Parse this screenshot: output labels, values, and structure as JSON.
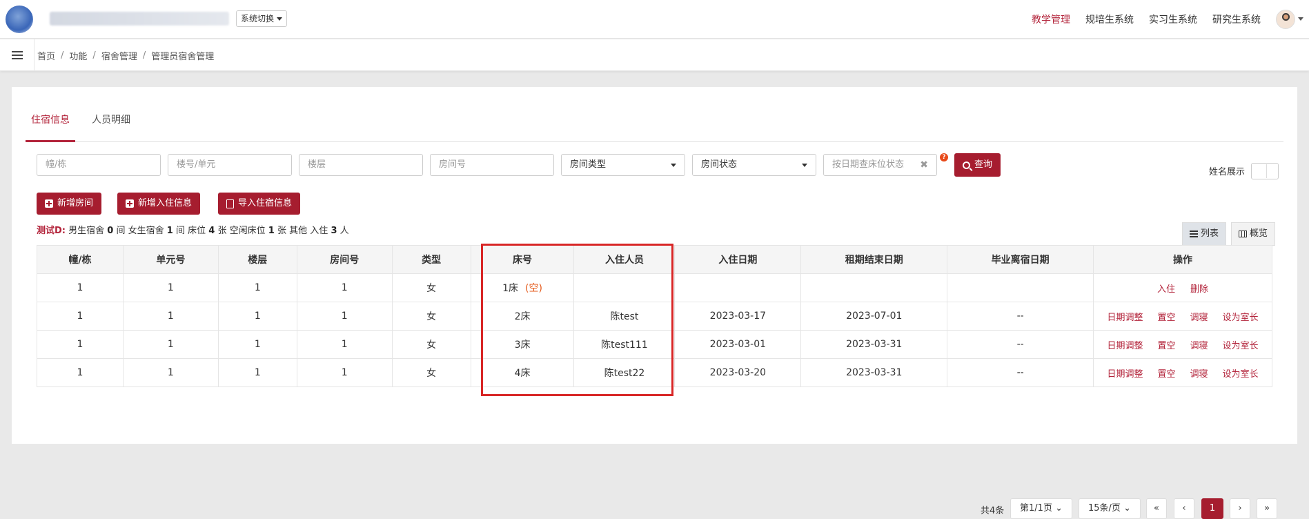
{
  "header": {
    "system_switch": "系统切换",
    "nav": [
      "教学管理",
      "规培生系统",
      "实习生系统",
      "研究生系统"
    ],
    "active_nav": "教学管理"
  },
  "breadcrumb": [
    "首页",
    "功能",
    "宿舍管理",
    "管理员宿舍管理"
  ],
  "tabs": [
    "住宿信息",
    "人员明细"
  ],
  "filters": {
    "building_placeholder": "幢/栋",
    "unit_placeholder": "楼号/单元",
    "floor_placeholder": "楼层",
    "room_placeholder": "房间号",
    "room_type": "房间类型",
    "room_status": "房间状态",
    "date_placeholder": "按日期查床位状态",
    "search_label": "查询"
  },
  "actions": {
    "add_room": "新增房间",
    "add_checkin": "新增入住信息",
    "import": "导入住宿信息"
  },
  "stats": {
    "name": "测试D:",
    "text_male": "男生宿舍",
    "male": "0",
    "unit_room": "间",
    "text_female": "女生宿舍",
    "female": "1",
    "text_beds": "床位",
    "beds": "4",
    "unit_bed": "张",
    "text_free": "空闲床位",
    "free": "1",
    "text_other": "其他",
    "text_checkin": "入住",
    "checkin": "3",
    "unit_person": "人"
  },
  "name_display_label": "姓名展示",
  "view": {
    "list": "列表",
    "overview": "概览"
  },
  "table": {
    "headers": [
      "幢/栋",
      "单元号",
      "楼层",
      "房间号",
      "类型",
      "床号",
      "入住人员",
      "入住日期",
      "租期结束日期",
      "毕业离宿日期",
      "操作"
    ],
    "rows": [
      {
        "building": "1",
        "unit": "1",
        "floor": "1",
        "room": "1",
        "type": "女",
        "bed": "1床",
        "empty": "(空)",
        "person": "",
        "checkin": "",
        "lease_end": "",
        "leave": "",
        "ops": [
          "入住",
          "删除"
        ]
      },
      {
        "building": "1",
        "unit": "1",
        "floor": "1",
        "room": "1",
        "type": "女",
        "bed": "2床",
        "empty": "",
        "person": "陈test",
        "checkin": "2023-03-17",
        "lease_end": "2023-07-01",
        "leave": "--",
        "ops": [
          "日期调整",
          "置空",
          "调寝",
          "设为室长"
        ]
      },
      {
        "building": "1",
        "unit": "1",
        "floor": "1",
        "room": "1",
        "type": "女",
        "bed": "3床",
        "empty": "",
        "person": "陈test111",
        "checkin": "2023-03-01",
        "lease_end": "2023-03-31",
        "leave": "--",
        "ops": [
          "日期调整",
          "置空",
          "调寝",
          "设为室长"
        ]
      },
      {
        "building": "1",
        "unit": "1",
        "floor": "1",
        "room": "1",
        "type": "女",
        "bed": "4床",
        "empty": "",
        "person": "陈test22",
        "checkin": "2023-03-20",
        "lease_end": "2023-03-31",
        "leave": "--",
        "ops": [
          "日期调整",
          "置空",
          "调寝",
          "设为室长"
        ]
      }
    ]
  },
  "pagination": {
    "total": "共4条",
    "page_select": "第1/1页",
    "size_select": "15条/页",
    "first": "«",
    "prev": "‹",
    "current": "1",
    "next": "›",
    "last": "»"
  },
  "colors": {
    "accent": "#a61d2f",
    "link": "#3e5da8",
    "highlight_box": "#d82626"
  }
}
